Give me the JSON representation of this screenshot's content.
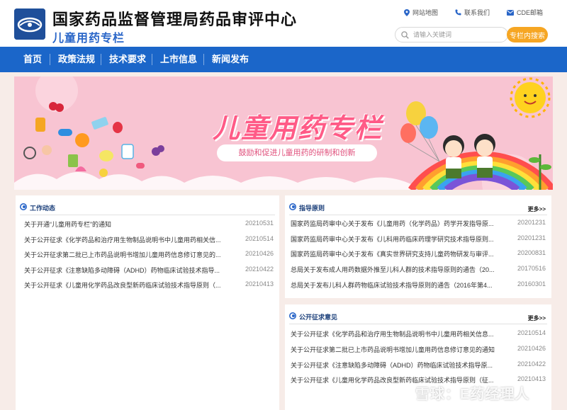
{
  "header": {
    "site_title": "国家药品监督管理局药品审评中心",
    "site_subtitle": "儿童用药专栏",
    "links": [
      {
        "label": "网站地图",
        "icon": "location-pin-icon"
      },
      {
        "label": "联系我们",
        "icon": "phone-icon"
      },
      {
        "label": "CDE邮箱",
        "icon": "mail-icon"
      }
    ],
    "search": {
      "placeholder": "请输入关键词",
      "value": "",
      "button_label": "专栏内搜索"
    }
  },
  "nav": {
    "items": [
      "首页",
      "政策法规",
      "技术要求",
      "上市信息",
      "新闻发布"
    ]
  },
  "banner": {
    "title": "儿童用药专栏",
    "slogan": "鼓励和促进儿童用药的研制和创新"
  },
  "panels": {
    "work": {
      "title": "工作动态",
      "items": [
        {
          "title": "关于开通“儿童用药专栏”的通知",
          "date": "20210531"
        },
        {
          "title": "关于公开征求《化学药品和治疗用生物制品说明书中儿童用药相关信...",
          "date": "20210514"
        },
        {
          "title": "关于公开征求第二批已上市药品说明书增加儿童用药信息修订意见的...",
          "date": "20210426"
        },
        {
          "title": "关于公开征求《注意缺陷多动障碍（ADHD）药物临床试验技术指导...",
          "date": "20210422"
        },
        {
          "title": "关于公开征求《儿童用化学药品改良型新药临床试验技术指导原则（...",
          "date": "20210413"
        }
      ]
    },
    "guide": {
      "title": "指导原则",
      "more": "更多>>",
      "items": [
        {
          "title": "国家药监局药审中心关于发布《儿童用药（化学药品）药学开发指导原...",
          "date": "20201231"
        },
        {
          "title": "国家药监局药审中心关于发布《儿科用药临床药理学研究技术指导原则...",
          "date": "20201231"
        },
        {
          "title": "国家药监局药审中心关于发布《真实世界研究支持儿童药物研发与审评...",
          "date": "20200831"
        },
        {
          "title": "总局关于发布成人用药数据外推至儿科人群的技术指导原则的通告（20...",
          "date": "20170516"
        },
        {
          "title": "总局关于发布儿科人群药物临床试验技术指导原则的通告（2016年第4...",
          "date": "20160301"
        }
      ]
    },
    "consult": {
      "title": "公开征求意见",
      "more": "更多>>",
      "items": [
        {
          "title": "关于公开征求《化学药品和治疗用生物制品说明书中儿童用药相关信息...",
          "date": "20210514"
        },
        {
          "title": "关于公开征求第二批已上市药品说明书增加儿童用药信息修订意见的通知",
          "date": "20210426"
        },
        {
          "title": "关于公开征求《注意缺陷多动障碍（ADHD）药物临床试验技术指导原...",
          "date": "20210422"
        },
        {
          "title": "关于公开征求《儿童用化学药品改良型新药临床试验技术指导原则（征...",
          "date": "20210413"
        }
      ]
    }
  },
  "watermark": "雪球：E药经理人",
  "colors": {
    "nav": "#1b66c9",
    "accent": "#f6a623",
    "banner": "#f8c4d2",
    "title_pink": "#ff5b87"
  }
}
